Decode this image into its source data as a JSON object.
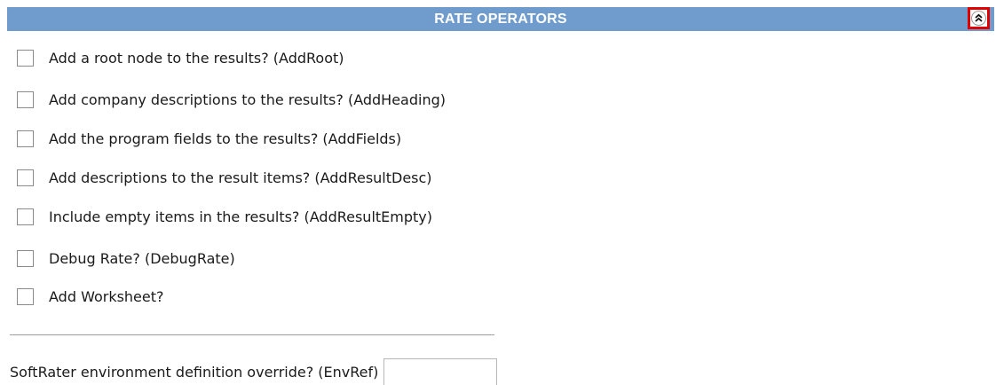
{
  "section": {
    "title": "RATE OPERATORS",
    "collapse_icon": "double-chevron-up-icon",
    "highlight_color": "#e00000",
    "header_color": "#6f9ccc"
  },
  "options": [
    {
      "label": "Add a root node to the results? (AddRoot)",
      "checked": false
    },
    {
      "label": "Add company descriptions to the results? (AddHeading)",
      "checked": false
    },
    {
      "label": "Add the program fields to the results? (AddFields)",
      "checked": false
    },
    {
      "label": "Add descriptions to the result items? (AddResultDesc)",
      "checked": false
    },
    {
      "label": "Include empty items in the results? (AddResultEmpty)",
      "checked": false
    },
    {
      "label": "Debug Rate? (DebugRate)",
      "checked": false
    },
    {
      "label": "Add Worksheet?",
      "checked": false
    }
  ],
  "env_override": {
    "label": "SoftRater environment definition override? (EnvRef)",
    "value": ""
  }
}
